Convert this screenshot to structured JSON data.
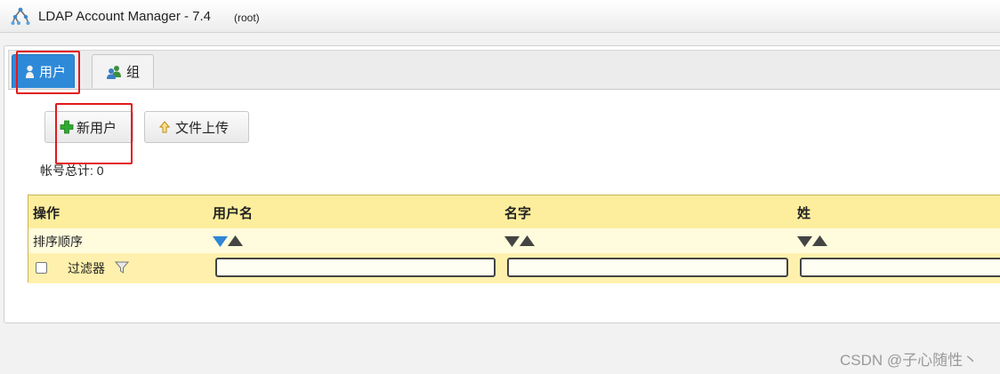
{
  "window": {
    "title": "LDAP Account Manager - 7.4",
    "user": "(root)"
  },
  "tabs": [
    {
      "label": "用户",
      "icon": "user-icon",
      "active": true
    },
    {
      "label": "组",
      "icon": "group-icon",
      "active": false
    }
  ],
  "toolbar": {
    "new_user_label": "新用户",
    "upload_label": "文件上传"
  },
  "account_total": "帐号总计: 0",
  "table": {
    "columns": [
      "操作",
      "用户名",
      "名字",
      "姓"
    ],
    "sort_label": "排序顺序",
    "filter_label": "过滤器",
    "filters": [
      "",
      "",
      ""
    ]
  },
  "colors": {
    "tab_active": "#2e8ad8",
    "table_header": "#fdee9d",
    "table_filter_row": "#fff1ad",
    "highlight": "#e3191b"
  },
  "watermark": "CSDN @子心随性丶"
}
